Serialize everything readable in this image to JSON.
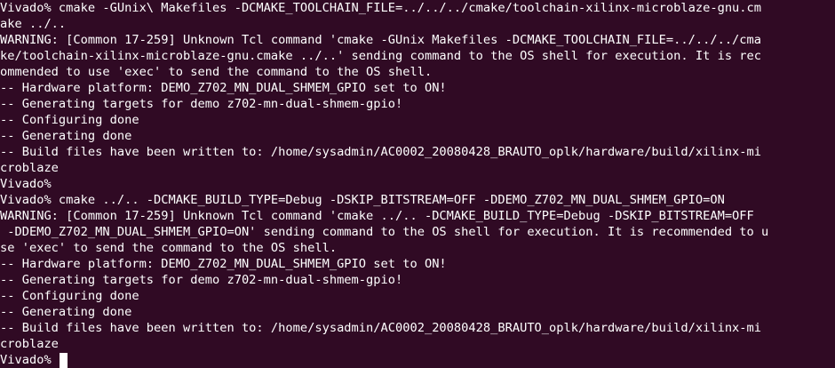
{
  "terminal": {
    "lines": [
      "Vivado% cmake -GUnix\\ Makefiles -DCMAKE_TOOLCHAIN_FILE=../../../cmake/toolchain-xilinx-microblaze-gnu.cm",
      "ake ../..",
      "WARNING: [Common 17-259] Unknown Tcl command 'cmake -GUnix Makefiles -DCMAKE_TOOLCHAIN_FILE=../../../cma",
      "ke/toolchain-xilinx-microblaze-gnu.cmake ../..' sending command to the OS shell for execution. It is rec",
      "ommended to use 'exec' to send the command to the OS shell.",
      "-- Hardware platform: DEMO_Z702_MN_DUAL_SHMEM_GPIO set to ON!",
      "-- Generating targets for demo z702-mn-dual-shmem-gpio!",
      "-- Configuring done",
      "-- Generating done",
      "-- Build files have been written to: /home/sysadmin/AC0002_20080428_BRAUTO_oplk/hardware/build/xilinx-mi",
      "croblaze",
      "Vivado%",
      "Vivado% cmake ../.. -DCMAKE_BUILD_TYPE=Debug -DSKIP_BITSTREAM=OFF -DDEMO_Z702_MN_DUAL_SHMEM_GPIO=ON",
      "WARNING: [Common 17-259] Unknown Tcl command 'cmake ../.. -DCMAKE_BUILD_TYPE=Debug -DSKIP_BITSTREAM=OFF",
      " -DDEMO_Z702_MN_DUAL_SHMEM_GPIO=ON' sending command to the OS shell for execution. It is recommended to u",
      "se 'exec' to send the command to the OS shell.",
      "-- Hardware platform: DEMO_Z702_MN_DUAL_SHMEM_GPIO set to ON!",
      "-- Generating targets for demo z702-mn-dual-shmem-gpio!",
      "-- Configuring done",
      "-- Generating done",
      "-- Build files have been written to: /home/sysadmin/AC0002_20080428_BRAUTO_oplk/hardware/build/xilinx-mi",
      "croblaze"
    ],
    "prompt": "Vivado%",
    "input": ""
  },
  "colors": {
    "background": "#300a24",
    "foreground": "#ffffff"
  }
}
